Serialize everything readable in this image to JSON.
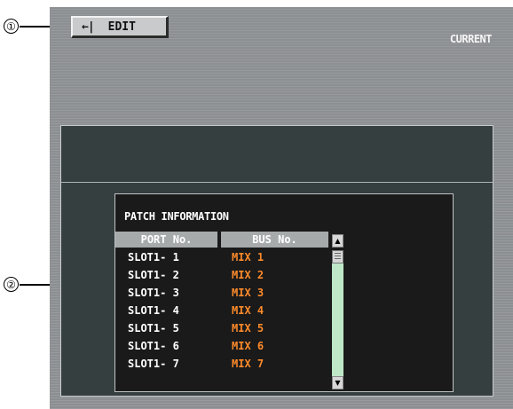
{
  "callouts": [
    "①",
    "②"
  ],
  "header": {
    "edit_arrow": "←|",
    "edit_label": "EDIT",
    "current_label": "CURRENT"
  },
  "patch": {
    "title": "PATCH INFORMATION",
    "columns": [
      "PORT No.",
      "BUS No."
    ],
    "rows": [
      {
        "port": "SLOT1- 1",
        "bus": "MIX 1"
      },
      {
        "port": "SLOT1- 2",
        "bus": "MIX 2"
      },
      {
        "port": "SLOT1- 3",
        "bus": "MIX 3"
      },
      {
        "port": "SLOT1- 4",
        "bus": "MIX 4"
      },
      {
        "port": "SLOT1- 5",
        "bus": "MIX 5"
      },
      {
        "port": "SLOT1- 6",
        "bus": "MIX 6"
      },
      {
        "port": "SLOT1- 7",
        "bus": "MIX 7"
      }
    ],
    "scroll_up_icon": "▲",
    "scroll_down_icon": "▼"
  },
  "colors": {
    "bus_value": "#ff8b2a",
    "panel_bg": "#8c8f92",
    "inner_bg": "#363f40",
    "scroll_track": "#bfe6c6"
  }
}
